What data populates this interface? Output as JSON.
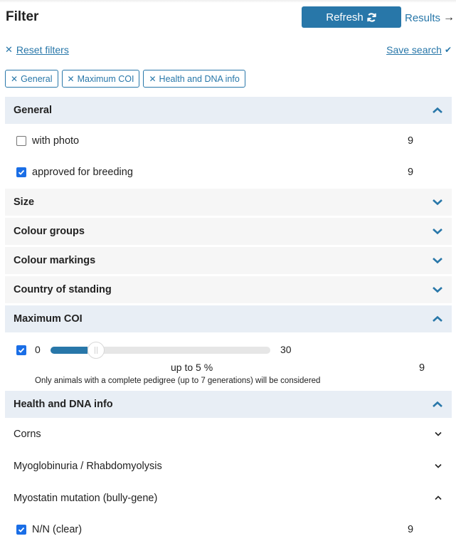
{
  "header": {
    "title": "Filter",
    "refresh_label": "Refresh",
    "results_label": "Results",
    "results_arrow": "→"
  },
  "actions": {
    "reset_icon": "✕",
    "reset_label": "Reset filters",
    "save_label": "Save search",
    "save_icon": "✔"
  },
  "chips": [
    {
      "label": "General"
    },
    {
      "label": "Maximum COI"
    },
    {
      "label": "Health and DNA info"
    }
  ],
  "chip_icon": "✕",
  "colors": {
    "accent": "#2877a9",
    "checkbox": "#1a6ee6",
    "open_section_bg": "#e8eef5",
    "closed_section_bg": "#f6f6f6"
  },
  "sections": {
    "general": {
      "title": "General",
      "options": [
        {
          "label": "with photo",
          "checked": false,
          "count": "9"
        },
        {
          "label": "approved for breeding",
          "checked": true,
          "count": "9"
        }
      ]
    },
    "size": {
      "title": "Size"
    },
    "colour_groups": {
      "title": "Colour groups"
    },
    "colour_markings": {
      "title": "Colour markings"
    },
    "country": {
      "title": "Country of standing"
    },
    "coi": {
      "title": "Maximum COI",
      "checked": true,
      "min": "0",
      "max": "30",
      "value": 5,
      "value_label": "up to 5 %",
      "note": "Only animals with a complete pedigree (up to 7 generations) will be considered",
      "count": "9"
    },
    "health": {
      "title": "Health and DNA info",
      "subsections": [
        {
          "label": "Corns",
          "expanded": false
        },
        {
          "label": "Myoglobinuria / Rhabdomyolysis",
          "expanded": false
        },
        {
          "label": "Myostatin mutation (bully-gene)",
          "expanded": true
        }
      ],
      "options": [
        {
          "label": "N/N (clear)",
          "checked": true,
          "count": "9"
        }
      ]
    }
  }
}
